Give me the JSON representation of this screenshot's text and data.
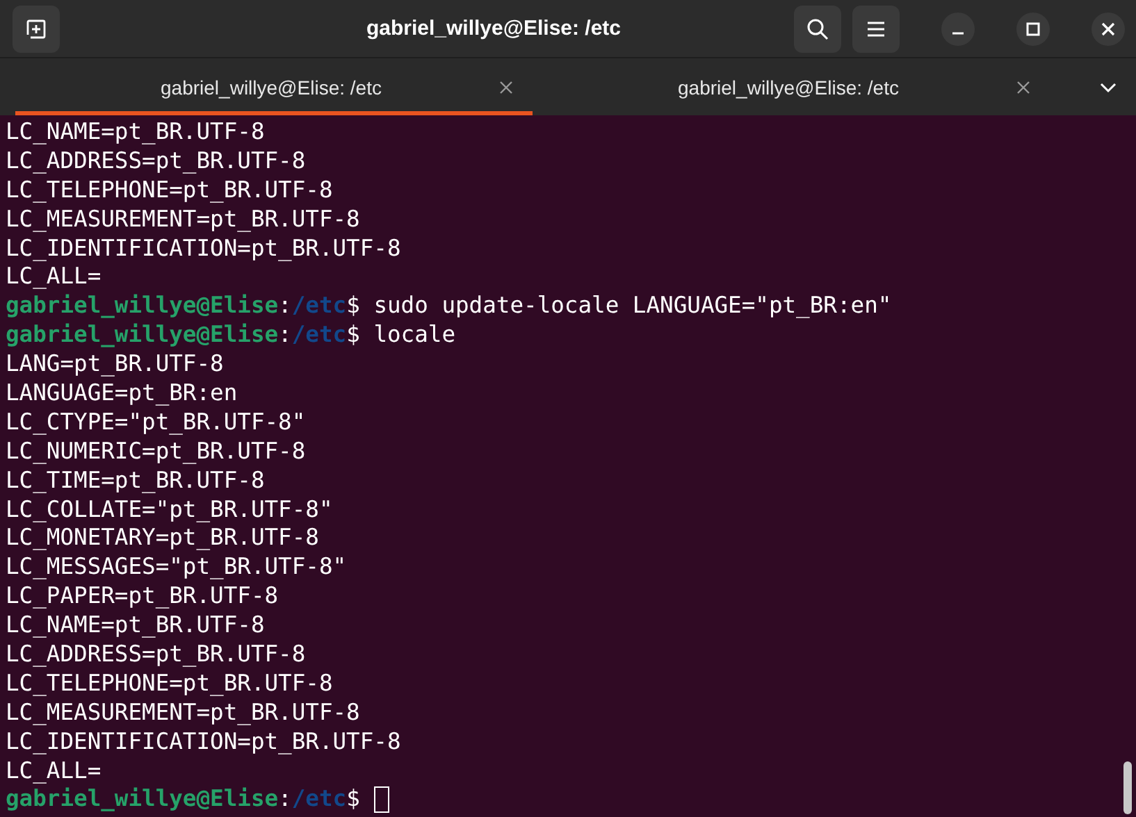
{
  "window": {
    "title": "gabriel_willye@Elise: /etc"
  },
  "tabs": [
    {
      "label": "gabriel_willye@Elise: /etc",
      "selected": true
    },
    {
      "label": "gabriel_willye@Elise: /etc",
      "selected": false
    }
  ],
  "terminal": {
    "lines": [
      {
        "kind": "output",
        "text": "LC_NAME=pt_BR.UTF-8"
      },
      {
        "kind": "output",
        "text": "LC_ADDRESS=pt_BR.UTF-8"
      },
      {
        "kind": "output",
        "text": "LC_TELEPHONE=pt_BR.UTF-8"
      },
      {
        "kind": "output",
        "text": "LC_MEASUREMENT=pt_BR.UTF-8"
      },
      {
        "kind": "output",
        "text": "LC_IDENTIFICATION=pt_BR.UTF-8"
      },
      {
        "kind": "output",
        "text": "LC_ALL="
      },
      {
        "kind": "prompt",
        "user": "gabriel_willye@Elise",
        "separator": ":",
        "path": "/etc",
        "symbol": "$",
        "command": "sudo update-locale LANGUAGE=\"pt_BR:en\""
      },
      {
        "kind": "prompt",
        "user": "gabriel_willye@Elise",
        "separator": ":",
        "path": "/etc",
        "symbol": "$",
        "command": "locale"
      },
      {
        "kind": "output",
        "text": "LANG=pt_BR.UTF-8"
      },
      {
        "kind": "output",
        "text": "LANGUAGE=pt_BR:en"
      },
      {
        "kind": "output",
        "text": "LC_CTYPE=\"pt_BR.UTF-8\""
      },
      {
        "kind": "output",
        "text": "LC_NUMERIC=pt_BR.UTF-8"
      },
      {
        "kind": "output",
        "text": "LC_TIME=pt_BR.UTF-8"
      },
      {
        "kind": "output",
        "text": "LC_COLLATE=\"pt_BR.UTF-8\""
      },
      {
        "kind": "output",
        "text": "LC_MONETARY=pt_BR.UTF-8"
      },
      {
        "kind": "output",
        "text": "LC_MESSAGES=\"pt_BR.UTF-8\""
      },
      {
        "kind": "output",
        "text": "LC_PAPER=pt_BR.UTF-8"
      },
      {
        "kind": "output",
        "text": "LC_NAME=pt_BR.UTF-8"
      },
      {
        "kind": "output",
        "text": "LC_ADDRESS=pt_BR.UTF-8"
      },
      {
        "kind": "output",
        "text": "LC_TELEPHONE=pt_BR.UTF-8"
      },
      {
        "kind": "output",
        "text": "LC_MEASUREMENT=pt_BR.UTF-8"
      },
      {
        "kind": "output",
        "text": "LC_IDENTIFICATION=pt_BR.UTF-8"
      },
      {
        "kind": "output",
        "text": "LC_ALL="
      },
      {
        "kind": "prompt",
        "user": "gabriel_willye@Elise",
        "separator": ":",
        "path": "/etc",
        "symbol": "$",
        "cursor": true
      }
    ]
  }
}
